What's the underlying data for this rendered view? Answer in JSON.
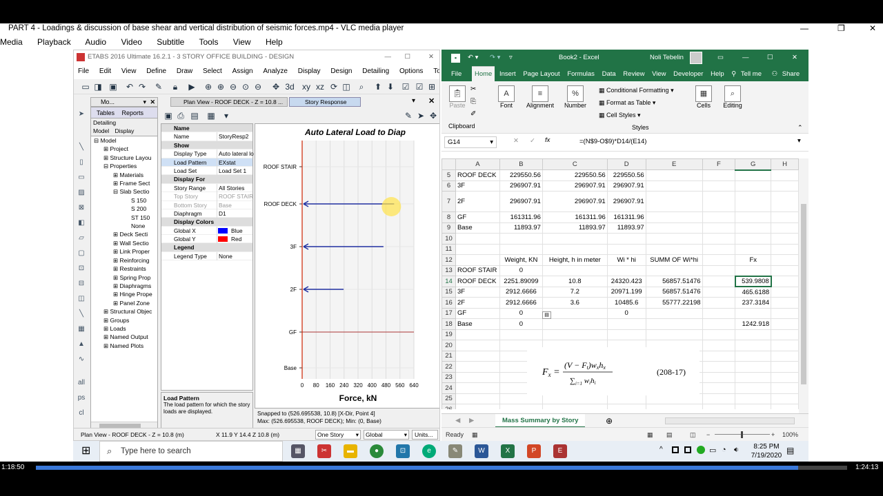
{
  "vlc": {
    "title": "PART 4 - Loadings & discussion of base shear and vertical distribution of seismic forces.mp4 - VLC media player",
    "menu": [
      "Media",
      "Playback",
      "Audio",
      "Video",
      "Subtitle",
      "Tools",
      "View",
      "Help"
    ],
    "elapsed": "1:18:50",
    "total": "1:24:13",
    "progress": 0.94
  },
  "etabs": {
    "title": "ETABS 2016 Ultimate 16.2.1 - 3 STORY OFFICE BUILDING - DESIGN",
    "menu": [
      "File",
      "Edit",
      "View",
      "Define",
      "Draw",
      "Select",
      "Assign",
      "Analyze",
      "Display",
      "Design",
      "Detailing",
      "Options",
      "Tools"
    ],
    "model_tab": "Mo...",
    "plan_tab": "Plan View - ROOF DECK - Z = 10.8 ...",
    "response_tab": "Story Response",
    "panel_tabs": [
      "Tables",
      "Reports",
      "Detailing",
      "Model",
      "Display"
    ],
    "tree": [
      "Model",
      "Project",
      "Structure Layou",
      "Properties",
      "Materials",
      "Frame Sect",
      "Slab Sectio",
      "S 150",
      "S 200",
      "ST 150",
      "None",
      "Deck Secti",
      "Wall Sectio",
      "Link Proper",
      "Reinforcing",
      "Restraints",
      "Spring Prop",
      "Diaphragms",
      "Hinge Prope",
      "Panel Zone",
      "Structural Objec",
      "Groups",
      "Loads",
      "Named Output",
      "Named Plots"
    ],
    "props": {
      "name_header": "Name",
      "name_key": "Name",
      "name_val": "StoryResp2",
      "show_header": "Show",
      "display_type_key": "Display Type",
      "display_type_val": "Auto lateral lo",
      "load_pattern_key": "Load Pattern",
      "load_pattern_val": "EXstat",
      "load_set_key": "Load Set",
      "load_set_val": "Load Set 1",
      "display_for_header": "Display For",
      "story_range_key": "Story Range",
      "story_range_val": "All Stories",
      "top_story_key": "Top Story",
      "top_story_val": "ROOF STAIR",
      "bottom_story_key": "Bottom Story",
      "bottom_story_val": "Base",
      "diaphragm_key": "Diaphragm",
      "diaphragm_val": "D1",
      "colors_header": "Display Colors",
      "gx_key": "Global X",
      "gx_val": "Blue",
      "gy_key": "Global Y",
      "gy_val": "Red",
      "legend_header": "Legend",
      "legend_key": "Legend Type",
      "legend_val": "None"
    },
    "desc_title": "Load Pattern",
    "desc_text": "The load pattern for which the story loads are displayed.",
    "snap_line1": "Snapped to (526.695538, 10.8)   [X-Dir, Point 4]",
    "snap_line2": "Max: (526.695538, ROOF DECK);   Min: (0, Base)",
    "status_left": "Plan View - ROOF DECK - Z = 10.8 (m)",
    "status_coords": "X 11.9  Y 14.4  Z 10.8 (m)",
    "status_story": "One Story",
    "status_coord_sys": "Global",
    "status_units": "Units..."
  },
  "chart_data": {
    "type": "bar",
    "title": "Auto Lateral Load to Diap",
    "xlabel": "Force, kN",
    "ylabel": "",
    "categories": [
      "ROOF STAIR",
      "ROOF DECK",
      "3F",
      "2F",
      "GF",
      "Base"
    ],
    "values": [
      0,
      526.695538,
      465.6188,
      237.3184,
      0,
      0
    ],
    "xlim": [
      0,
      640
    ],
    "xticks": [
      "0",
      "80",
      "160",
      "240",
      "320",
      "400",
      "480",
      "560",
      "640"
    ],
    "grid": true,
    "colors": {
      "bar": "#1f2fa0",
      "axis": "#cc2200"
    }
  },
  "excel": {
    "title": "Book2 - Excel",
    "user": "Noli Tebelin",
    "tabs": [
      "File",
      "Home",
      "Insert",
      "Page Layout",
      "Formulas",
      "Data",
      "Review",
      "View",
      "Developer",
      "Help",
      "Tell me",
      "Share"
    ],
    "ribbon": {
      "paste": "Paste",
      "clipboard": "Clipboard",
      "font": "Font",
      "alignment": "Alignment",
      "number": "Number",
      "cond_fmt": "Conditional Formatting",
      "fmt_table": "Format as Table",
      "cell_styles": "Cell Styles",
      "styles": "Styles",
      "cells": "Cells",
      "editing": "Editing"
    },
    "namebox": "G14",
    "formula": "=(N$9-O$9)*D14/(E14)",
    "columns": [
      "A",
      "B",
      "C",
      "D",
      "E",
      "F",
      "G",
      "H"
    ],
    "rows": [
      {
        "n": "5",
        "c": [
          "ROOF DECK",
          "229550.56",
          "229550.56",
          "229550.56",
          "",
          "",
          "",
          ""
        ]
      },
      {
        "n": "6",
        "c": [
          "3F",
          "296907.91",
          "296907.91",
          "296907.91",
          "",
          "",
          "",
          ""
        ]
      },
      {
        "n": "7",
        "c": [
          "2F",
          "296907.91",
          "296907.91",
          "296907.91",
          "",
          "",
          "",
          ""
        ]
      },
      {
        "n": "8",
        "c": [
          "GF",
          "161311.96",
          "161311.96",
          "161311.96",
          "",
          "",
          "",
          ""
        ]
      },
      {
        "n": "9",
        "c": [
          "Base",
          "11893.97",
          "11893.97",
          "11893.97",
          "",
          "",
          "",
          ""
        ]
      },
      {
        "n": "10",
        "c": [
          "",
          "",
          "",
          "",
          "",
          "",
          "",
          ""
        ]
      },
      {
        "n": "11",
        "c": [
          "",
          "",
          "",
          "",
          "",
          "",
          "",
          ""
        ]
      },
      {
        "n": "12",
        "c": [
          "",
          "Weight, KN",
          "Height, h in meter",
          "Wi * hi",
          "SUMM OF Wi*hi",
          "",
          "Fx",
          ""
        ]
      },
      {
        "n": "13",
        "c": [
          "ROOF STAIR",
          "0",
          "",
          "",
          "",
          "",
          "",
          ""
        ]
      },
      {
        "n": "14",
        "c": [
          "ROOF DECK",
          "2251.89099",
          "10.8",
          "24320.423",
          "56857.51476",
          "",
          "539.9808",
          ""
        ]
      },
      {
        "n": "15",
        "c": [
          "3F",
          "2912.6666",
          "7.2",
          "20971.199",
          "56857.51476",
          "",
          "465.6188",
          ""
        ]
      },
      {
        "n": "16",
        "c": [
          "2F",
          "2912.6666",
          "3.6",
          "10485.6",
          "55777.22198",
          "",
          "237.3184",
          ""
        ]
      },
      {
        "n": "17",
        "c": [
          "GF",
          "0",
          "",
          "0",
          "",
          "",
          "",
          ""
        ]
      },
      {
        "n": "18",
        "c": [
          "Base",
          "0",
          "",
          "",
          "",
          "",
          "1242.918",
          ""
        ]
      },
      {
        "n": "19",
        "c": [
          "",
          "",
          "",
          "",
          "",
          "",
          "",
          ""
        ]
      },
      {
        "n": "20",
        "c": [
          "",
          "",
          "",
          "",
          "",
          "",
          "",
          ""
        ]
      },
      {
        "n": "21",
        "c": [
          "",
          "",
          "",
          "",
          "",
          "",
          "",
          ""
        ]
      },
      {
        "n": "22",
        "c": [
          "",
          "",
          "",
          "",
          "",
          "",
          "",
          ""
        ]
      },
      {
        "n": "23",
        "c": [
          "",
          "",
          "",
          "",
          "",
          "",
          "",
          ""
        ]
      },
      {
        "n": "24",
        "c": [
          "",
          "",
          "",
          "",
          "",
          "",
          "",
          ""
        ]
      },
      {
        "n": "25",
        "c": [
          "",
          "",
          "",
          "",
          "",
          "",
          "",
          ""
        ]
      },
      {
        "n": "26",
        "c": [
          "",
          "",
          "",
          "",
          "",
          "",
          "",
          ""
        ]
      }
    ],
    "formula_image": {
      "lhs": "F",
      "sub": "x",
      "num": "(V − F",
      "den": "w",
      "ref": "(208-17)"
    },
    "sheet_tab": "Mass Summary by Story",
    "status_ready": "Ready",
    "zoom": "100%"
  },
  "taskbar": {
    "search_placeholder": "Type here to search",
    "time": "8:25 PM",
    "date": "7/19/2020"
  }
}
